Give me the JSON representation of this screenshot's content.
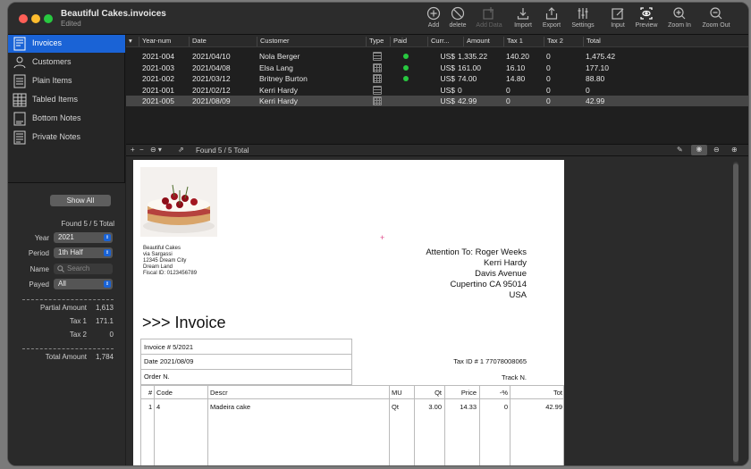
{
  "window": {
    "title": "Beautiful Cakes.invoices",
    "subtitle": "Edited"
  },
  "toolbar": [
    {
      "label": "Add",
      "icon": "plus-circle-icon",
      "enabled": true
    },
    {
      "label": "delete",
      "icon": "no-entry-icon",
      "enabled": true
    },
    {
      "label": "Add Data",
      "icon": "add-data-icon",
      "enabled": false
    },
    {
      "label": "Import",
      "icon": "import-icon",
      "enabled": true
    },
    {
      "label": "Export",
      "icon": "export-icon",
      "enabled": true
    },
    {
      "label": "Settings",
      "icon": "sliders-icon",
      "enabled": true
    },
    {
      "label": "Input",
      "icon": "edit-icon",
      "enabled": true
    },
    {
      "label": "Preview",
      "icon": "preview-icon",
      "enabled": true
    },
    {
      "label": "Zoom In",
      "icon": "zoom-in-icon",
      "enabled": true
    },
    {
      "label": "Zoom Out",
      "icon": "zoom-out-icon",
      "enabled": true
    }
  ],
  "sidebar": {
    "items": [
      {
        "label": "Invoices",
        "icon": "invoices-icon",
        "selected": true
      },
      {
        "label": "Customers",
        "icon": "customers-icon",
        "selected": false
      },
      {
        "label": "Plain Items",
        "icon": "plain-items-icon",
        "selected": false
      },
      {
        "label": "Tabled Items",
        "icon": "tabled-items-icon",
        "selected": false
      },
      {
        "label": "Bottom Notes",
        "icon": "bottom-notes-icon",
        "selected": false
      },
      {
        "label": "Private Notes",
        "icon": "private-notes-icon",
        "selected": false
      }
    ]
  },
  "filters": {
    "show_all": "Show All",
    "found": "Found 5 / 5 Total",
    "year_label": "Year",
    "year_value": "2021",
    "period_label": "Period",
    "period_value": "1th Half",
    "name_label": "Name",
    "name_placeholder": "Search",
    "payed_label": "Payed",
    "payed_value": "All"
  },
  "totals": [
    {
      "label": "Partial Amount",
      "value": "1,613"
    },
    {
      "label": "Tax 1",
      "value": "171.1"
    },
    {
      "label": "Tax 2",
      "value": "0"
    },
    {
      "label": "Total Amount",
      "value": "1,784"
    }
  ],
  "table": {
    "headers": [
      "Year-num",
      "Date",
      "Customer",
      "Type",
      "Paid",
      "Curr...",
      "Amount",
      "Tax 1",
      "Tax 2",
      "Total"
    ],
    "rows": [
      {
        "yearnum": "2021-004",
        "date": "2021/04/10",
        "customer": "Nola Berger",
        "type": "plain",
        "paid": true,
        "curr": "US$",
        "amount": "1,335.22",
        "tax1": "140.20",
        "tax2": "0",
        "total": "1,475.42"
      },
      {
        "yearnum": "2021-003",
        "date": "2021/04/08",
        "customer": "Elsa Lang",
        "type": "tabled",
        "paid": true,
        "curr": "US$",
        "amount": "161.00",
        "tax1": "16.10",
        "tax2": "0",
        "total": "177.10"
      },
      {
        "yearnum": "2021-002",
        "date": "2021/03/12",
        "customer": "Britney Burton",
        "type": "tabled",
        "paid": true,
        "curr": "US$",
        "amount": "74.00",
        "tax1": "14.80",
        "tax2": "0",
        "total": "88.80"
      },
      {
        "yearnum": "2021-001",
        "date": "2021/02/12",
        "customer": "Kerri Hardy",
        "type": "plain",
        "paid": false,
        "curr": "US$",
        "amount": "0",
        "tax1": "0",
        "tax2": "0",
        "total": "0"
      },
      {
        "yearnum": "2021-005",
        "date": "2021/08/09",
        "customer": "Kerri Hardy",
        "type": "tabled",
        "paid": false,
        "curr": "US$",
        "amount": "42.99",
        "tax1": "0",
        "tax2": "0",
        "total": "42.99",
        "selected": true
      }
    ]
  },
  "table_bar": {
    "found": "Found 5 / 5 Total"
  },
  "invoice": {
    "company_lines": [
      "Beautiful Cakes",
      "via Sargassi",
      "12345 Dream City",
      "Dream Land",
      "Fiscal ID: 0123456789"
    ],
    "address_lines": [
      "Attention To: Roger Weeks",
      "Kerri Hardy",
      "Davis Avenue",
      "Cupertino CA 95014",
      "USA"
    ],
    "heading": ">>> Invoice",
    "invoice_no": "Invoice # 5/2021",
    "date": "Date 2021/08/09",
    "order": "Order N.",
    "tax_id": "Tax ID # 1 77078008065",
    "track": "Track N.",
    "item_headers": [
      "#",
      "Code",
      "Descr",
      "MU",
      "Qt",
      "Price",
      "-%",
      "Tot"
    ],
    "items": [
      {
        "n": "1",
        "code": "4",
        "descr": "Madeira cake",
        "mu": "Qt",
        "qt": "3.00",
        "price": "14.33",
        "disc": "0",
        "tot": "42.99"
      }
    ]
  },
  "colors": {
    "accent": "#1a63d6",
    "paid": "#28c840"
  }
}
